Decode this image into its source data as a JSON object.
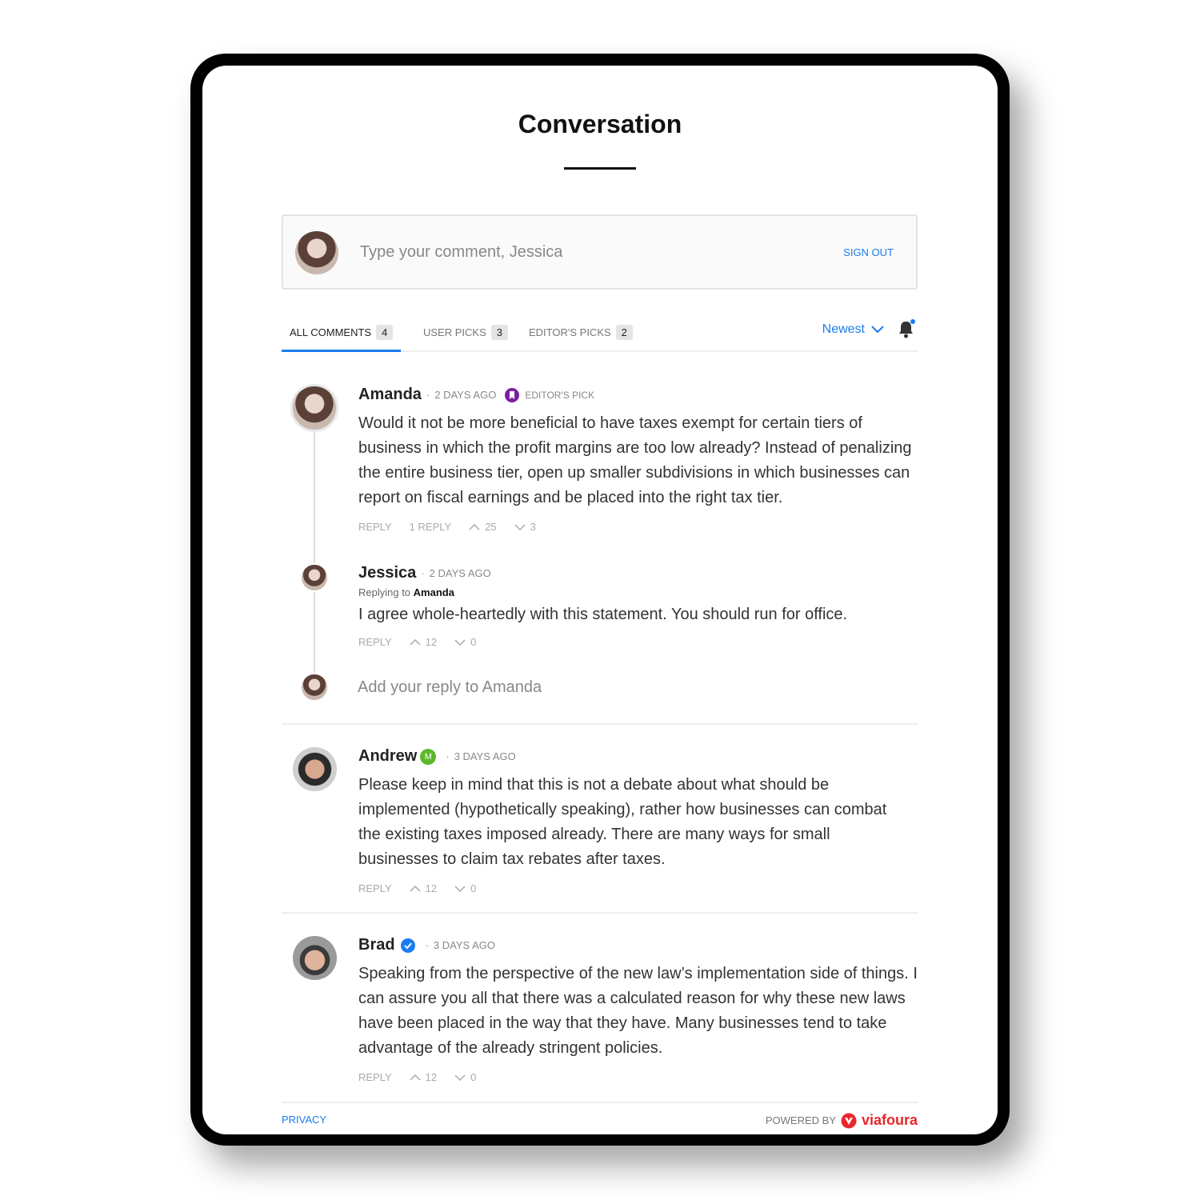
{
  "title": "Conversation",
  "composer": {
    "placeholder": "Type your comment, Jessica",
    "sign_out": "SIGN OUT"
  },
  "tabs": [
    {
      "label": "ALL COMMENTS",
      "count": "4",
      "active": true
    },
    {
      "label": "USER PICKS",
      "count": "3"
    },
    {
      "label": "EDITOR'S PICKS",
      "count": "2"
    }
  ],
  "sort": {
    "selected": "Newest"
  },
  "accent": "#1a7cf0",
  "comments": [
    {
      "author": "Amanda",
      "time": "2 DAYS AGO",
      "badge": "EDITOR'S PICK",
      "text": "Would it not be more beneficial to have taxes exempt for certain tiers of business in which the profit margins are too low already? Instead of penalizing the entire business tier, open up smaller subdivisions in which businesses can report on fiscal earnings and be placed into the right tax tier.",
      "reply": "REPLY",
      "replies": "1 REPLY",
      "up": "25",
      "down": "3",
      "children": [
        {
          "author": "Jessica",
          "time": "2 DAYS AGO",
          "replying_label": "Replying to",
          "replying_to": "Amanda",
          "text": "I agree whole-heartedly with this statement. You should run for office.",
          "reply": "REPLY",
          "up": "12",
          "down": "0"
        }
      ],
      "reply_placeholder": "Add your reply to Amanda"
    },
    {
      "author": "Andrew",
      "moderator_badge": "M",
      "time": "3 DAYS AGO",
      "text": "Please keep in mind that this is not a debate about what should be implemented (hypothetically speaking), rather how businesses can combat the existing taxes imposed already. There are many ways for small businesses to claim tax rebates after taxes.",
      "reply": "REPLY",
      "up": "12",
      "down": "0"
    },
    {
      "author": "Brad",
      "verified": true,
      "time": "3 DAYS AGO",
      "text": "Speaking from the perspective of the new law’s implementation side of things. I can assure you all that there was a calculated reason for why these new laws have been placed in the way that they have. Many businesses tend to take advantage of the already stringent policies.",
      "reply": "REPLY",
      "up": "12",
      "down": "0"
    }
  ],
  "footer": {
    "privacy": "PRIVACY",
    "powered_by": "POWERED BY",
    "brand": "viafoura"
  }
}
